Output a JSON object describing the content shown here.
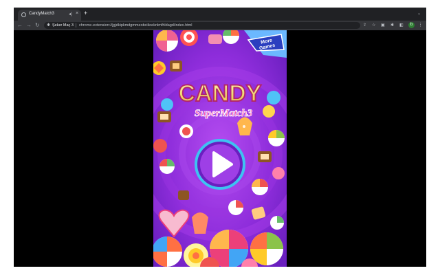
{
  "tab": {
    "title": "CandyMatch3",
    "audio_icon": "speaker-icon",
    "close_icon": "close-icon"
  },
  "toolbar": {
    "extension_name": "Şeker Maç 3",
    "url": "chrome-extension://jgjdkipkmdgmmeobcilioeknlmfhldagd/index.html",
    "profile_initial": "b"
  },
  "game": {
    "badge_line1": "More",
    "badge_line2": "Games",
    "title_main": "CANDY",
    "title_sub": "SuperMatch3",
    "play_icon": "play-icon"
  },
  "colors": {
    "game_bg": "#8b2fd6",
    "title_yellow": "#f6e27a",
    "title_pink": "#ff49a8",
    "play_ring": "#3ec3f2"
  }
}
